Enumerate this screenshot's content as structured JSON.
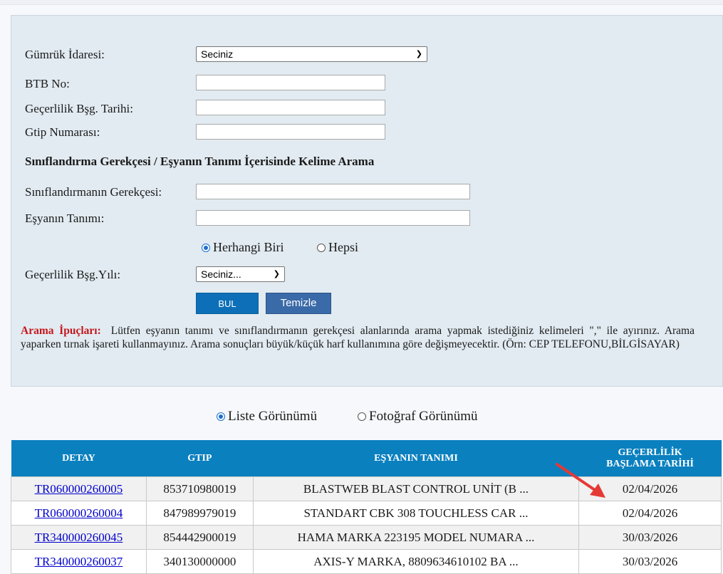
{
  "form": {
    "gumruk_label": "Gümrük İdaresi:",
    "gumruk_value": "Seciniz",
    "btb_label": "BTB No:",
    "gecerlilik_tarih_label": "Geçerlilik Bşg. Tarihi:",
    "gtip_label": "Gtip Numarası:",
    "search_heading": "Sınıflandırma Gerekçesi / Eşyanın Tanımı İçerisinde Kelime Arama",
    "gerekce_label": "Sınıflandırmanın Gerekçesi:",
    "tanim_label": "Eşyanın Tanımı:",
    "match_any_label": "Herhangi Biri",
    "match_all_label": "Hepsi",
    "yil_label": "Geçerlilik Bşg.Yılı:",
    "yil_value": "Seciniz...",
    "bul_label": "BUL",
    "temizle_label": "Temizle"
  },
  "tips": {
    "heading": "Arama İpuçları:",
    "text": "Lütfen eşyanın tanımı ve sınıflandırmanın gerekçesi alanlarında arama yapmak istediğiniz kelimeleri \",\" ile ayırınız. Arama yaparken tırnak işareti kullanmayınız. Arama sonuçları büyük/küçük harf kullanımına göre değişmeyecektir. (Örn: CEP TELEFONU,BİLGİSAYAR)"
  },
  "view": {
    "list_label": "Liste Görünümü",
    "photo_label": "Fotoğraf Görünümü",
    "selected": "list"
  },
  "table": {
    "headers": {
      "detay": "DETAY",
      "gtip": "GTIP",
      "tanim": "EŞYANIN TANIMI",
      "tarih_line1": "GEÇERLİLİK",
      "tarih_line2": "BAŞLAMA TARİHİ"
    },
    "rows": [
      {
        "detay": "TR060000260005",
        "gtip": "853710980019",
        "tanim": "BLASTWEB BLAST CONTROL UNİT (B ...",
        "tarih": "02/04/2026"
      },
      {
        "detay": "TR060000260004",
        "gtip": "847989979019",
        "tanim": "STANDART CBK 308 TOUCHLESS CAR ...",
        "tarih": "02/04/2026"
      },
      {
        "detay": "TR340000260045",
        "gtip": "854442900019",
        "tanim": "HAMA MARKA 223195 MODEL NUMARA ...",
        "tarih": "30/03/2026"
      },
      {
        "detay": "TR340000260037",
        "gtip": "340130000000",
        "tanim": "AXIS-Y MARKA, 8809634610102 BA ...",
        "tarih": "30/03/2026"
      }
    ]
  },
  "colors": {
    "header_bg": "#0a80bf",
    "panel_bg": "#e2ebf1",
    "tips_heading": "#c4161c",
    "arrow": "#e53935"
  }
}
